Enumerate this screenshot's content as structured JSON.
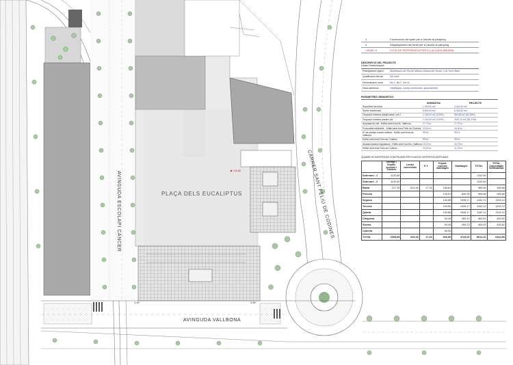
{
  "streets": {
    "avinguda_escolapi": "AVINGUDA ESCOLAPI CÀNCER",
    "avinguda_vallbona": "AVINGUDA VALLBONA",
    "carrer_sant_feliu": "CARRER SANT FELIU DE CODINES",
    "placa": "PLAÇA DELS EUCALIPTUS"
  },
  "map_marks": {
    "elevation": "+48.85",
    "corner_a": "4.45",
    "corner_b": "4.85"
  },
  "legend": [
    {
      "num": "1",
      "text": "Construcció del quiet per a l'accés al pàrquing",
      "red": false
    },
    {
      "num": "2",
      "text": "Desplaçament del fanal per a l'accés al pàrquing",
      "red": false
    },
    {
      "num": "+48.85 m",
      "text": "COTA DE REFERÈNCIA PER A L'ALÇADA MÀXIMA",
      "red": true
    }
  ],
  "description": {
    "title": "DESCRIPCIÓ DEL PROJECTE",
    "subtitle": "Dades Urbanístiques",
    "rows": [
      {
        "k": "Planejament vigent",
        "v": "Modificació del Pla de Millora Urbana del Sector 1 de Torre Baró"
      },
      {
        "k": "Qualificació del sòl",
        "v": "Sòl urbà"
      },
      {
        "k": "Denominació zona",
        "v": "Illa 1, Illa 2, Illa 16"
      },
      {
        "k": "Usos admesos",
        "v": "Habitatges, locals comercials i aparcaments"
      }
    ]
  },
  "params": {
    "title": "PARÀMETRES URBANÍSTICS",
    "col_normativa": "NORMATIVA",
    "col_projecte": "PROJECTE",
    "rows": [
      {
        "k": "Superfície del solar",
        "n": "1.410,00 m2",
        "p": "1.414,00 m2"
      },
      {
        "k": "Sostre residencial",
        "n": "6.600,00 m2",
        "p": "6.344,50 m2"
      },
      {
        "k": "Ocupació màxima planta baixa / pis 1",
        "n": "1.164,00 m2 (100%)",
        "p": "960,89 m2 (82,55%)"
      },
      {
        "k": "Ocupació màxima plantes pis",
        "n": "1.410,00 m2 (100%)",
        "p": "1152,12 m2 (82,13%)"
      },
      {
        "k": "Amplada de vial · Edifici amb front Av. Vallbona",
        "n": "17,70 m",
        "p": "17,70 m"
      },
      {
        "k": "Profunditat edificable · Edifici amb front Feliu de Codines",
        "n": "20,00 m",
        "p": "16,00 m"
      },
      {
        "k": "Nº de plantes màxim edificat · Edifici amb front Av. Vallbona",
        "n": "PB+4",
        "p": "PB+4"
      },
      {
        "k": "Edifici amb front Feliu de Codines",
        "n": "PB+6",
        "p": "PB+6"
      },
      {
        "k": "Alçada màxima reguladora · Edifici amb front Av. Vallbona",
        "n": "15,20 m",
        "p": "15,75 m"
      },
      {
        "k": "Edifici amb front Feliu de Codines",
        "n": "22,20 m",
        "p": "21,75 m"
      }
    ]
  },
  "surfaces": {
    "title": "QUADRE DE SUPERFÍCIES CONSTRUÏDES PER PLANTES SUPERFÍCIE EDIFICABLE",
    "headers": [
      "",
      "Garatge i Espais comuns i Trasters",
      "Locals comercials",
      "E.T.",
      "Espais comuns habitatges",
      "Habitatges",
      "TOTAL",
      "TOTAL Computable Edificabilitat"
    ],
    "rows": [
      [
        "Soterrani - 1",
        "1132,60",
        "",
        "",
        "",
        "",
        "1132,60",
        ""
      ],
      [
        "Soterrani - 2",
        "1132,60",
        "",
        "",
        "",
        "",
        "1132,60",
        ""
      ],
      [
        "Baixa",
        "127,29",
        "620,46",
        "17,34",
        "198,64",
        "",
        "965,66",
        "965,66"
      ],
      [
        "Primera",
        "",
        "",
        "",
        "125,61",
        "840,05",
        "965,66",
        "965,66"
      ],
      [
        "Segona",
        "",
        "",
        "",
        "133,65",
        "1028,17",
        "1152,12",
        "1152,12"
      ],
      [
        "Tercera",
        "",
        "",
        "",
        "133,65",
        "1028,17",
        "1152,12",
        "1152,12"
      ],
      [
        "Quarta",
        "",
        "",
        "",
        "133,65",
        "1028,17",
        "1152,12",
        "1152,12"
      ],
      [
        "Cinquena",
        "",
        "",
        "",
        "54,40",
        "409,22",
        "463,62",
        "463,62"
      ],
      [
        "Sisena",
        "",
        "",
        "",
        "54,40",
        "409,22",
        "463,62",
        "463,62"
      ],
      [
        "Coberta",
        "",
        "",
        "",
        "96,00",
        "",
        "",
        ""
      ],
      [
        "TOTAL",
        "2365,68",
        "620,46",
        "17,34",
        "930,00",
        "4743,00",
        "8611,22",
        "6344,50"
      ]
    ]
  }
}
